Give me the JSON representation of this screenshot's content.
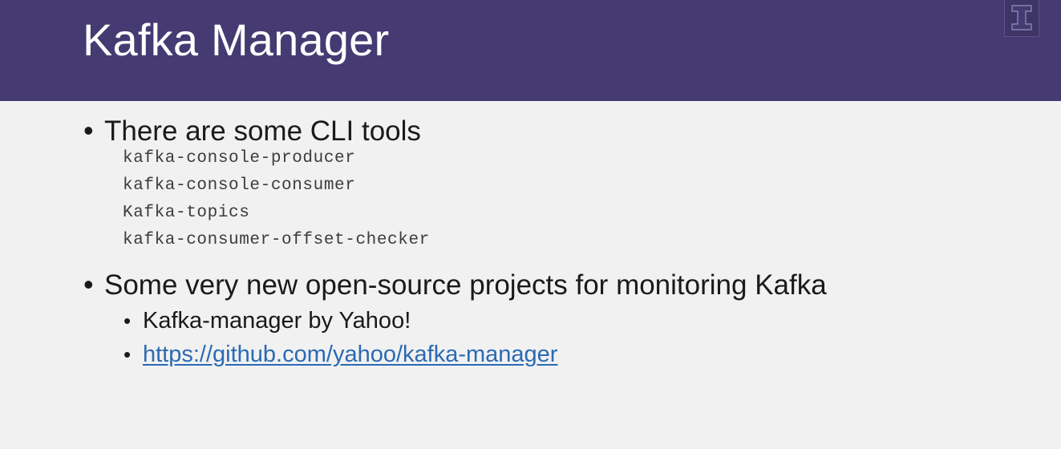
{
  "slide": {
    "title": "Kafka Manager",
    "bullets": [
      {
        "text": "There are some CLI tools",
        "code_lines": [
          "kafka-console-producer",
          "kafka-console-consumer",
          "Kafka-topics",
          "kafka-consumer-offset-checker"
        ]
      },
      {
        "text": "Some very new open-source projects for monitoring Kafka",
        "sub_bullets": [
          {
            "text": "Kafka-manager by Yahoo!"
          },
          {
            "text": "https://github.com/yahoo/kafka-manager",
            "is_link": true
          }
        ]
      }
    ],
    "bullet_glyph": "•",
    "logo_icon": "block-i-logo-icon"
  },
  "colors": {
    "header": "#453b72",
    "background": "#f1f1f1",
    "title_text": "#ffffff",
    "link": "#2a6ab5"
  }
}
